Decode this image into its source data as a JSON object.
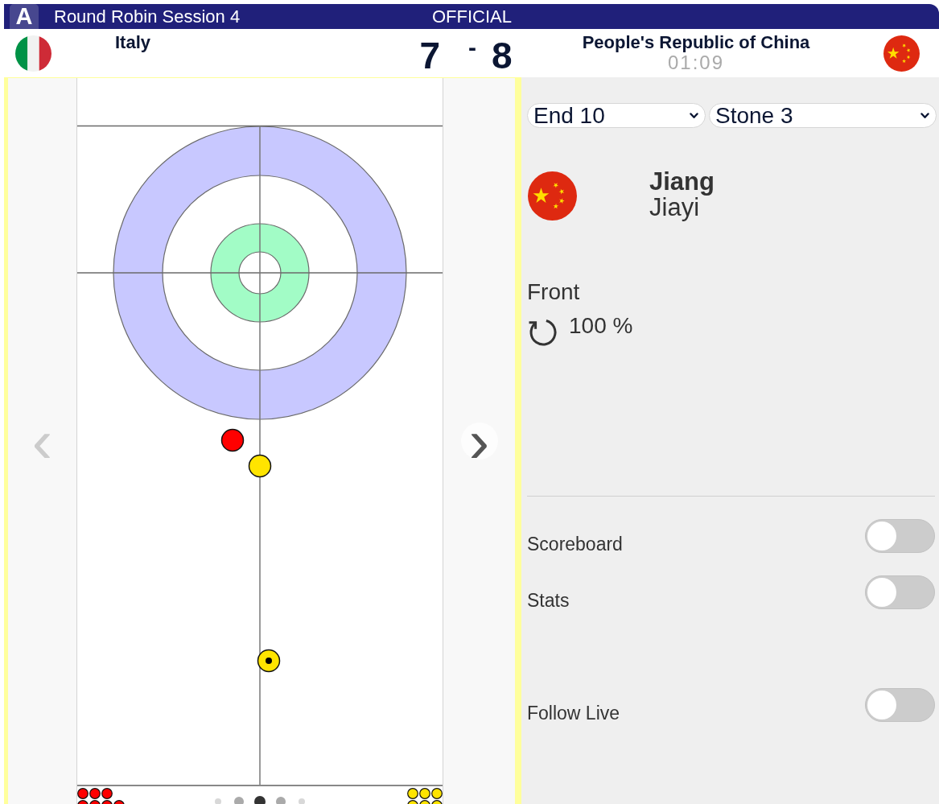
{
  "header": {
    "badge": "A",
    "title": "Round Robin Session 4",
    "status": "OFFICIAL"
  },
  "teams": [
    {
      "name": "Italy",
      "score": "7",
      "reserve_stones": [
        {
          "color": "#ff0000"
        },
        {
          "color": "#ff0000"
        },
        {
          "color": "#ff0000"
        },
        {
          "color": "#ff0000"
        },
        {
          "color": "#ff0000"
        },
        {
          "color": "#ff0000"
        },
        {
          "color": "#ff0000"
        }
      ]
    },
    {
      "name": "People's Republic of China",
      "score": "8",
      "clock": "01:09",
      "reserve_stones": [
        {
          "color": "#ffe400"
        },
        {
          "color": "#ffe400"
        },
        {
          "color": "#ffe400"
        },
        {
          "color": "#ffe400"
        },
        {
          "color": "#ffe400"
        },
        {
          "color": "#ffe400"
        }
      ]
    }
  ],
  "score_separator": "-",
  "sheet": {
    "stones": [
      {
        "color": "#ff0000",
        "current": false
      },
      {
        "color": "#ffe400",
        "current": false
      },
      {
        "color": "#ffe400",
        "current": true
      }
    ],
    "previous": {
      "label": "‹",
      "disabled": true
    },
    "next": {
      "label": "›",
      "disabled": false
    },
    "pager": [
      {
        "selected": false
      },
      {
        "selected": false
      },
      {
        "selected": true
      },
      {
        "selected": false
      },
      {
        "selected": false
      }
    ]
  },
  "selectors": [
    {
      "value": "End 10"
    },
    {
      "value": "Stone 3"
    }
  ],
  "player": {
    "surname": "Jiang",
    "given_name": "Jiayi",
    "position": "Front",
    "percentage": "100 %"
  },
  "toggles": [
    {
      "label": "Scoreboard",
      "on": false
    },
    {
      "label": "Stats",
      "on": false
    },
    {
      "label": "Follow Live",
      "on": false
    }
  ]
}
